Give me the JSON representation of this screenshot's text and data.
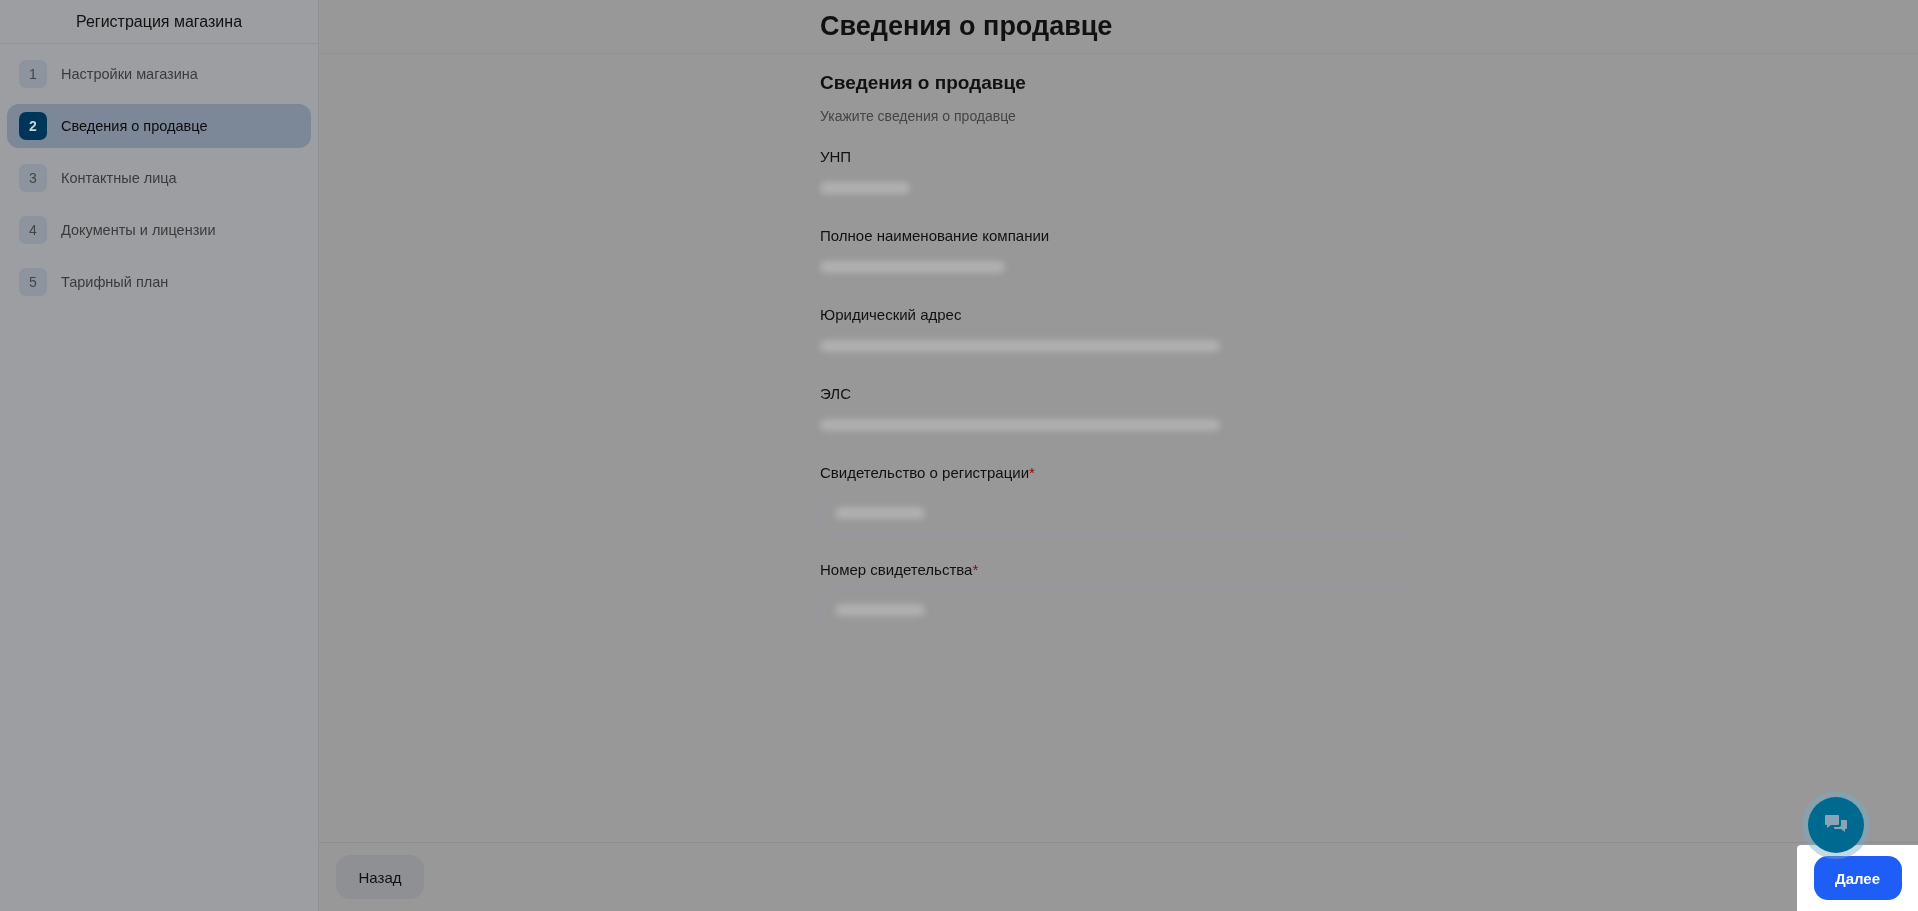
{
  "sidebar": {
    "title": "Регистрация магазина",
    "steps": [
      {
        "number": "1",
        "label": "Настройки магазина",
        "selected": false
      },
      {
        "number": "2",
        "label": "Сведения о продавце",
        "selected": true
      },
      {
        "number": "3",
        "label": "Контактные лица",
        "selected": false
      },
      {
        "number": "4",
        "label": "Документы и лицензии",
        "selected": false
      },
      {
        "number": "5",
        "label": "Тарифный план",
        "selected": false
      }
    ]
  },
  "page": {
    "title": "Сведения о продавце"
  },
  "form": {
    "heading": "Сведения о продавце",
    "subtitle": "Укажите сведения о продавце",
    "fields": [
      {
        "label": "УНП",
        "kind": "static"
      },
      {
        "label": "Полное наименование компании",
        "kind": "static"
      },
      {
        "label": "Юридический адрес",
        "kind": "static"
      },
      {
        "label": "ЭЛС",
        "kind": "static"
      },
      {
        "label": "Свидетельство о регистрации",
        "required_mark": "*",
        "kind": "input"
      },
      {
        "label": "Номер свидетельства",
        "required_mark": "*",
        "kind": "input"
      }
    ]
  },
  "footer": {
    "back": "Назад",
    "next": "Далее"
  }
}
